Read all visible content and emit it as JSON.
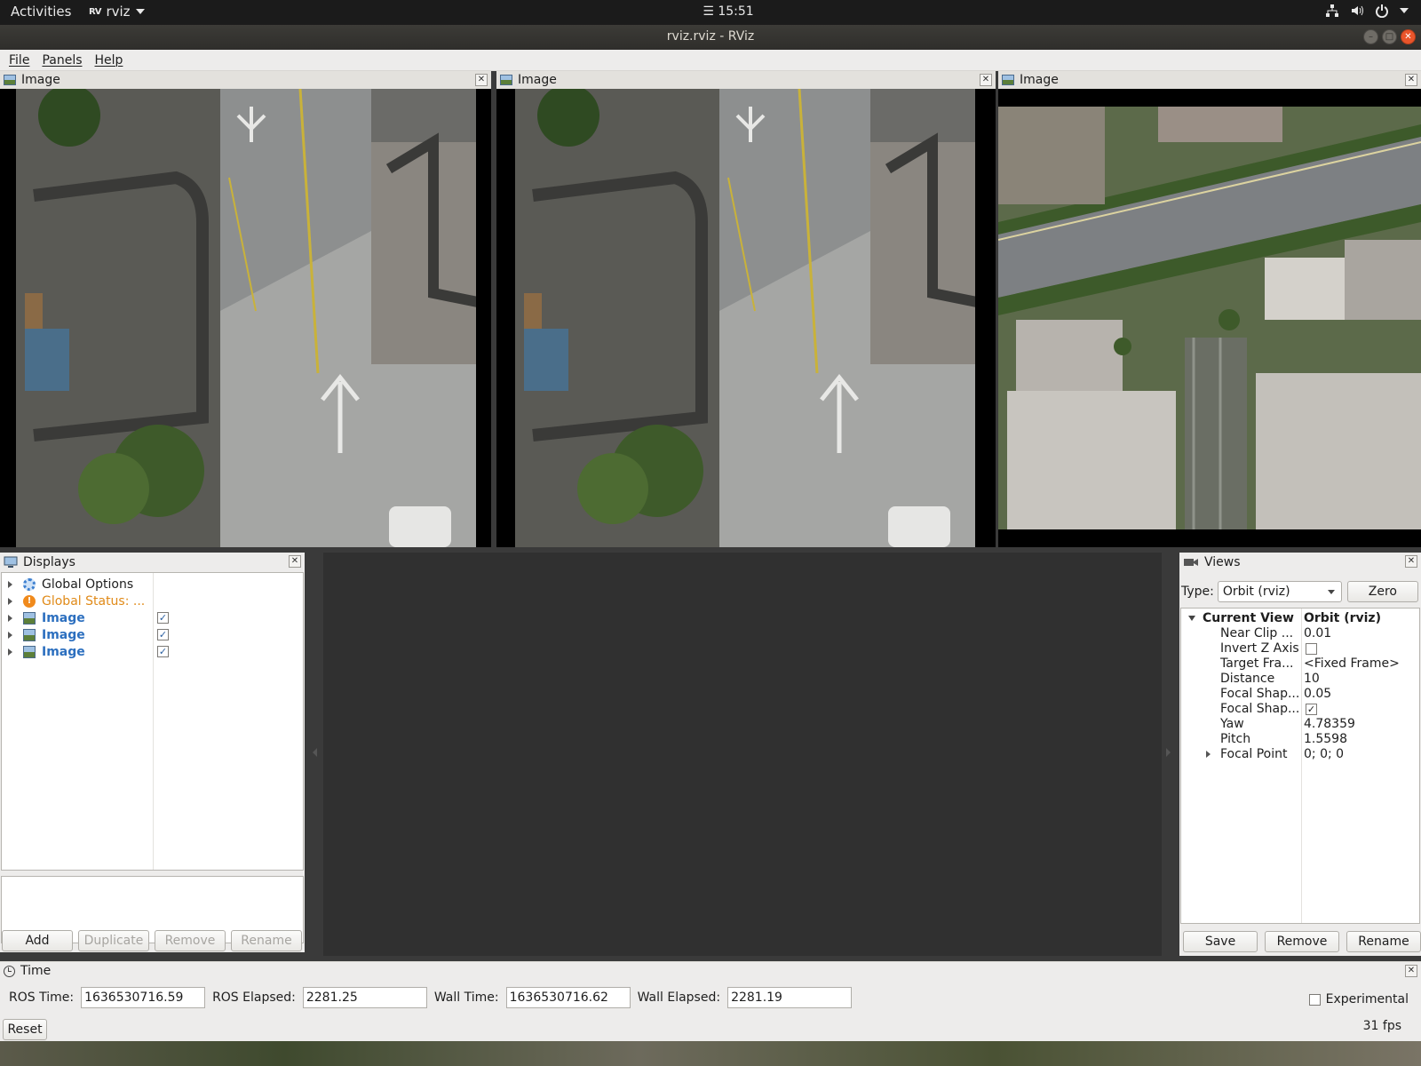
{
  "topbar": {
    "activities": "Activities",
    "app_name": "rviz",
    "clock": "☰ 15:51"
  },
  "window": {
    "title": "rviz.rviz - RViz"
  },
  "menu": [
    "File",
    "Panels",
    "Help"
  ],
  "image_panels": [
    {
      "title": "Image"
    },
    {
      "title": "Image"
    },
    {
      "title": "Image"
    }
  ],
  "displays": {
    "title": "Displays",
    "items": [
      {
        "label": "Global Options",
        "icon": "gear-icon",
        "checked": null
      },
      {
        "label": "Global Status: ...",
        "icon": "warning-icon",
        "checked": null
      },
      {
        "label": "Image",
        "icon": "image-icon",
        "checked": true
      },
      {
        "label": "Image",
        "icon": "image-icon",
        "checked": true
      },
      {
        "label": "Image",
        "icon": "image-icon",
        "checked": true
      }
    ],
    "buttons": {
      "add": "Add",
      "duplicate": "Duplicate",
      "remove": "Remove",
      "rename": "Rename"
    }
  },
  "views": {
    "title": "Views",
    "type_label": "Type:",
    "type_value": "Orbit (rviz)",
    "zero_button": "Zero",
    "current_view": {
      "label": "Current View",
      "value": "Orbit (rviz)"
    },
    "properties": [
      {
        "key": "Near Clip ...",
        "value": "0.01"
      },
      {
        "key": "Invert Z Axis",
        "value": "",
        "checkbox": false
      },
      {
        "key": "Target Fra...",
        "value": "<Fixed Frame>"
      },
      {
        "key": "Distance",
        "value": "10"
      },
      {
        "key": "Focal Shap...",
        "value": "0.05"
      },
      {
        "key": "Focal Shap...",
        "value": "",
        "checkbox": true
      },
      {
        "key": "Yaw",
        "value": "4.78359"
      },
      {
        "key": "Pitch",
        "value": "1.5598"
      },
      {
        "key": "Focal Point",
        "value": "0; 0; 0"
      }
    ],
    "buttons": {
      "save": "Save",
      "remove": "Remove",
      "rename": "Rename"
    }
  },
  "time": {
    "title": "Time",
    "ros_time_label": "ROS Time:",
    "ros_time": "1636530716.59",
    "ros_elapsed_label": "ROS Elapsed:",
    "ros_elapsed": "2281.25",
    "wall_time_label": "Wall Time:",
    "wall_time": "1636530716.62",
    "wall_elapsed_label": "Wall Elapsed:",
    "wall_elapsed": "2281.19",
    "experimental_label": "Experimental",
    "reset_button": "Reset",
    "fps": "31 fps"
  }
}
